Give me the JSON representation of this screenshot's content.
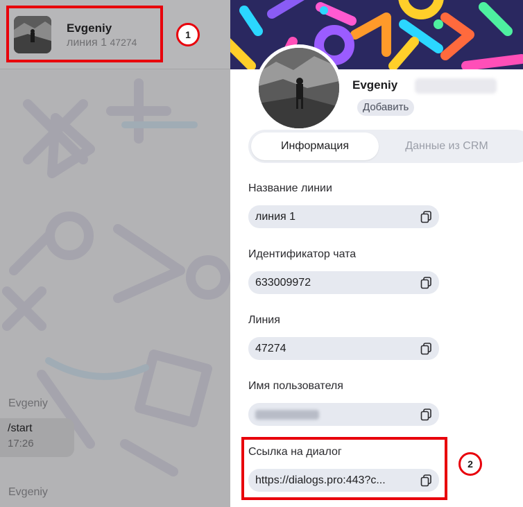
{
  "chat_header": {
    "name": "Evgeniy",
    "line": "линия 1",
    "line_id": "47274"
  },
  "messages": {
    "sender_1": "Evgeniy",
    "text_1": "/start",
    "time_1": "17:26",
    "sender_2": "Evgeniy"
  },
  "annotations": {
    "badge_1": "1",
    "badge_2": "2",
    "color": "#e8000b"
  },
  "profile": {
    "name": "Evgeniy",
    "add_label": "Добавить"
  },
  "tabs": {
    "info": "Информация",
    "crm": "Данные из CRM"
  },
  "fields": {
    "line_name_label": "Название линии",
    "line_name_value": "линия 1",
    "chat_id_label": "Идентификатор чата",
    "chat_id_value": "633009972",
    "line_label": "Линия",
    "line_value": "47274",
    "username_label": "Имя пользователя",
    "dialog_link_label": "Ссылка на диалог",
    "dialog_link_value": "https://dialogs.pro:443?c..."
  },
  "icons": {
    "copy": "copy-icon"
  }
}
